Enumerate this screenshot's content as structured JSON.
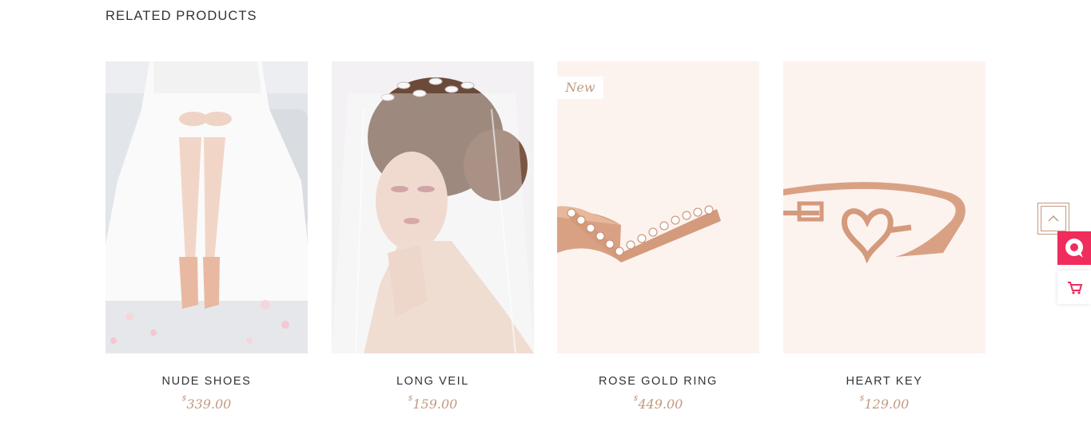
{
  "section": {
    "title": "RELATED PRODUCTS"
  },
  "products": [
    {
      "name": "NUDE SHOES",
      "currency": "$",
      "price": "339.00",
      "image_icon": "bride-dress-shoes-photo"
    },
    {
      "name": "LONG VEIL",
      "currency": "$",
      "price": "159.00",
      "image_icon": "bride-veil-photo"
    },
    {
      "name": "ROSE GOLD RING",
      "currency": "$",
      "price": "449.00",
      "badge": "New",
      "image_icon": "rose-gold-ring-photo"
    },
    {
      "name": "HEART KEY",
      "currency": "$",
      "price": "129.00",
      "image_icon": "heart-key-bracelet-photo"
    }
  ],
  "floating": {
    "to_top_icon": "chevron-up-icon",
    "chat_icon": "chat-bubble-icon",
    "cart_icon": "cart-icon"
  },
  "colors": {
    "accent_price": "#c29a82",
    "chat_bg": "#ef2c5b",
    "image_bg_jewelry": "#fcf3ef"
  }
}
